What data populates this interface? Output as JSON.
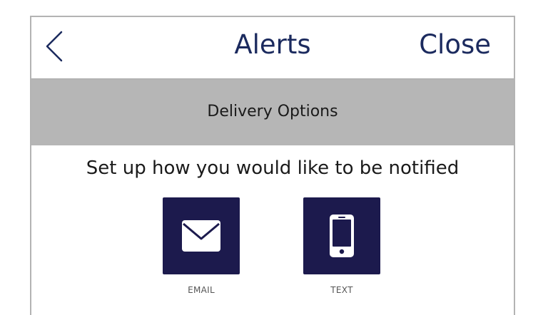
{
  "header": {
    "back_icon": "chevron-left-icon",
    "title": "Alerts",
    "close_label": "Close"
  },
  "section": {
    "title": "Delivery Options"
  },
  "prompt": {
    "text": "Set up how you would like to be notified"
  },
  "options": [
    {
      "label": "EMAIL",
      "icon": "envelope-icon"
    },
    {
      "label": "TEXT",
      "icon": "smartphone-icon"
    }
  ],
  "colors": {
    "brand_navy": "#1b2a5e",
    "tile_navy": "#1c1a4d",
    "band_gray": "#b6b6b6",
    "frame_border": "#b3b3b3"
  }
}
